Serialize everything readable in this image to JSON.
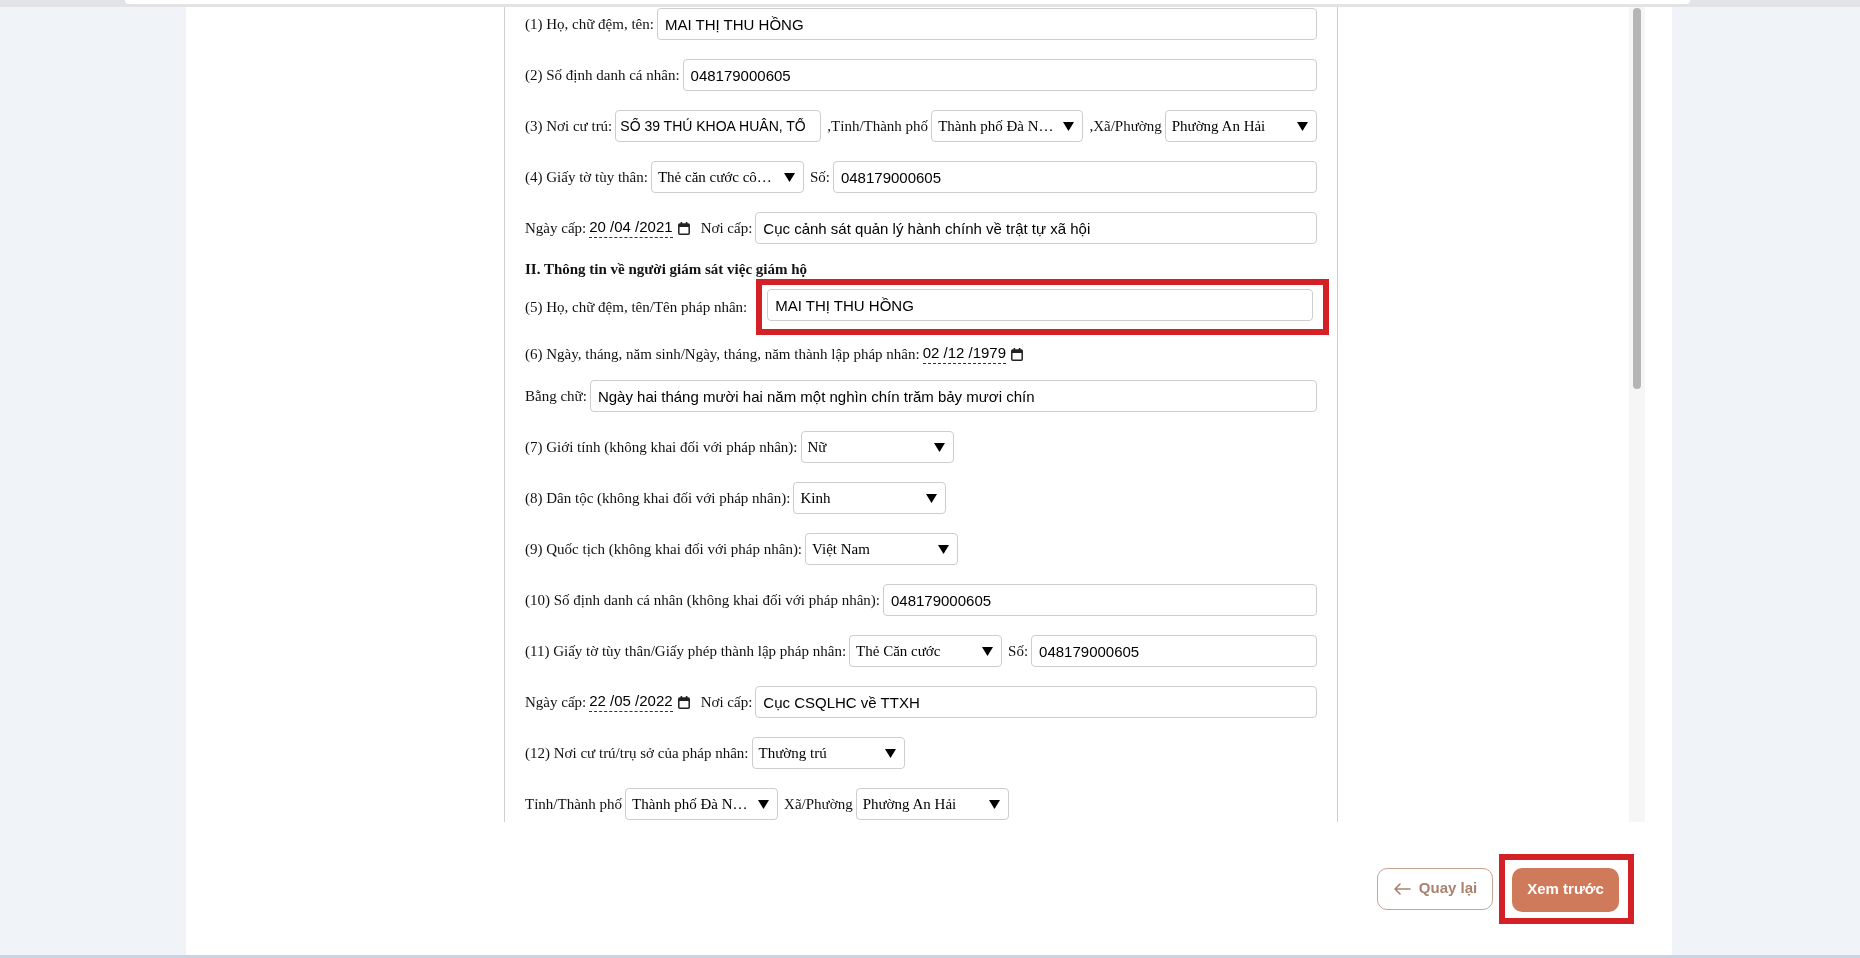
{
  "form": {
    "items": [
      {
        "kind": "row",
        "parts": [
          {
            "kind": "label",
            "text": "(1) Họ, chữ đệm, tên:"
          },
          {
            "kind": "input",
            "value": "MAI THỊ THU HỒNG",
            "highlighted": false
          }
        ]
      },
      {
        "kind": "row",
        "parts": [
          {
            "kind": "label",
            "text": "(2) Số định danh cá nhân:"
          },
          {
            "kind": "input",
            "value": "048179000605",
            "highlighted": false
          }
        ]
      },
      {
        "kind": "row",
        "parts": [
          {
            "kind": "label",
            "text": "(3) Nơi cư trú:"
          },
          {
            "kind": "input",
            "value": "SỐ 39 THỦ KHOA HUÂN, TỔ",
            "highlighted": false
          },
          {
            "kind": "label",
            "text": ",Tỉnh/Thành phố"
          },
          {
            "kind": "select",
            "value": "Thành phố Đà N…",
            "highlighted": false
          },
          {
            "kind": "label",
            "text": ",Xã/Phường"
          },
          {
            "kind": "select",
            "value": "Phường An Hải",
            "highlighted": false
          }
        ]
      },
      {
        "kind": "row",
        "parts": [
          {
            "kind": "label",
            "text": "(4) Giấy tờ tùy thân:"
          },
          {
            "kind": "select",
            "value": "Thẻ căn cước cô…",
            "highlighted": false
          },
          {
            "kind": "label",
            "text": "Số:"
          },
          {
            "kind": "input",
            "value": "048179000605",
            "highlighted": false
          }
        ]
      },
      {
        "kind": "row",
        "parts": [
          {
            "kind": "label",
            "text": "Ngày cấp:"
          },
          {
            "kind": "date",
            "value": "20 /04 /2021",
            "highlighted": false
          },
          {
            "kind": "label",
            "text": "Nơi cấp:"
          },
          {
            "kind": "input",
            "value": "Cục cảnh sát quản lý hành chính về trật tự xã hội",
            "highlighted": false
          }
        ]
      },
      {
        "kind": "heading",
        "text": "II. Thông tin về người giám sát việc giám hộ"
      },
      {
        "kind": "row",
        "parts": [
          {
            "kind": "label",
            "text": "(5) Họ, chữ đệm, tên/Tên pháp nhân:"
          },
          {
            "kind": "input",
            "value": "MAI THỊ THU HỒNG",
            "highlighted": true
          }
        ]
      },
      {
        "kind": "row",
        "parts": [
          {
            "kind": "label",
            "text": "(6) Ngày, tháng, năm sinh/Ngày, tháng, năm thành lập pháp nhân:"
          },
          {
            "kind": "date",
            "value": "02 /12 /1979",
            "highlighted": false
          }
        ]
      },
      {
        "kind": "row",
        "parts": [
          {
            "kind": "label",
            "text": "Bằng chữ:"
          },
          {
            "kind": "input",
            "value": "Ngày hai tháng mười hai năm một nghìn chín trăm bảy mươi chín",
            "highlighted": false
          }
        ]
      },
      {
        "kind": "row",
        "parts": [
          {
            "kind": "label",
            "text": "(7) Giới tính (không khai đối với pháp nhân):"
          },
          {
            "kind": "select",
            "value": "Nữ",
            "highlighted": false
          }
        ]
      },
      {
        "kind": "row",
        "parts": [
          {
            "kind": "label",
            "text": "(8) Dân tộc (không khai đối với pháp nhân):"
          },
          {
            "kind": "select",
            "value": "Kinh",
            "highlighted": false
          }
        ]
      },
      {
        "kind": "row",
        "parts": [
          {
            "kind": "label",
            "text": "(9) Quốc tịch (không khai đối với pháp nhân):"
          },
          {
            "kind": "select",
            "value": "Việt Nam",
            "highlighted": false
          }
        ]
      },
      {
        "kind": "row",
        "parts": [
          {
            "kind": "label",
            "text": "(10) Số định danh cá nhân (không khai đối với pháp nhân):"
          },
          {
            "kind": "input",
            "value": "048179000605",
            "highlighted": false
          }
        ]
      },
      {
        "kind": "row",
        "parts": [
          {
            "kind": "label",
            "text": "(11) Giấy tờ tùy thân/Giấy phép thành lập pháp nhân:"
          },
          {
            "kind": "select",
            "value": "Thẻ Căn cước",
            "highlighted": false
          },
          {
            "kind": "label",
            "text": "Số:"
          },
          {
            "kind": "input",
            "value": "048179000605",
            "highlighted": false
          }
        ]
      },
      {
        "kind": "row",
        "parts": [
          {
            "kind": "label",
            "text": "Ngày cấp:"
          },
          {
            "kind": "date",
            "value": "22 /05 /2022",
            "highlighted": false
          },
          {
            "kind": "label",
            "text": "Nơi cấp:"
          },
          {
            "kind": "input",
            "value": "Cục CSQLHC về TTXH",
            "highlighted": false
          }
        ]
      },
      {
        "kind": "row",
        "parts": [
          {
            "kind": "label",
            "text": "(12) Nơi cư trú/trụ sở của pháp nhân:"
          },
          {
            "kind": "select",
            "value": "Thường trú",
            "highlighted": false
          }
        ]
      },
      {
        "kind": "row",
        "parts": [
          {
            "kind": "label",
            "text": "Tỉnh/Thành phố"
          },
          {
            "kind": "select",
            "value": "Thành phố Đà N…",
            "highlighted": false
          },
          {
            "kind": "label",
            "text": "Xã/Phường"
          },
          {
            "kind": "select",
            "value": "Phường An Hải",
            "highlighted": false
          }
        ]
      }
    ]
  },
  "buttons": [
    {
      "kind": "back",
      "label": "Quay lại",
      "highlighted": false
    },
    {
      "kind": "primary",
      "label": "Xem trước",
      "highlighted": true
    }
  ]
}
